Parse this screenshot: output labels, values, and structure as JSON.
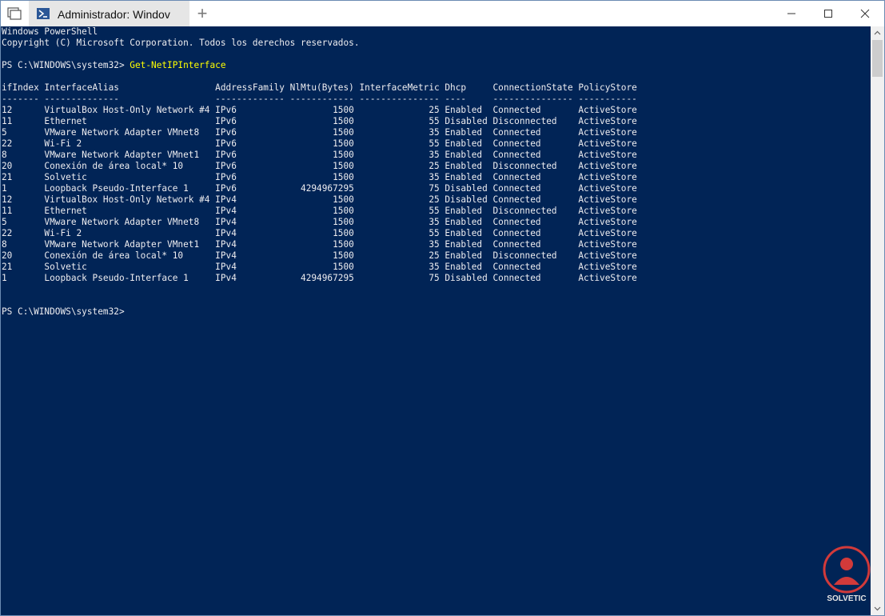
{
  "window": {
    "tab_title": "Administrador: Windov",
    "new_tab_symbol": "+",
    "icons": {
      "tab_switcher": "tab-switcher-icon",
      "tab": "powershell-icon",
      "minimize": "minimize-icon",
      "maximize": "maximize-icon",
      "close": "close-icon"
    }
  },
  "colors": {
    "console_background": "#012456",
    "console_text": "#eeedf0",
    "command_text": "#ffff00"
  },
  "console": {
    "banner_title": "Windows PowerShell",
    "banner_copyright": "Copyright (C) Microsoft Corporation. Todos los derechos reservados.",
    "prompt": "PS C:\\WINDOWS\\system32> ",
    "command": "Get-NetIPInterface",
    "final_prompt": "PS C:\\WINDOWS\\system32>",
    "table_header": "ifIndex InterfaceAlias                  AddressFamily NlMtu(Bytes) InterfaceMetric Dhcp     ConnectionState PolicyStore",
    "table_separator": "------- --------------                  ------------- ------------ --------------- ----     --------------- -----------",
    "columns": [
      "ifIndex",
      "InterfaceAlias",
      "AddressFamily",
      "NlMtu(Bytes)",
      "InterfaceMetric",
      "Dhcp",
      "ConnectionState",
      "PolicyStore"
    ],
    "rows": [
      [
        "12",
        "VirtualBox Host-Only Network #4",
        "IPv6",
        "1500",
        "25",
        "Enabled",
        "Connected",
        "ActiveStore"
      ],
      [
        "11",
        "Ethernet",
        "IPv6",
        "1500",
        "55",
        "Disabled",
        "Disconnected",
        "ActiveStore"
      ],
      [
        "5",
        "VMware Network Adapter VMnet8",
        "IPv6",
        "1500",
        "35",
        "Enabled",
        "Connected",
        "ActiveStore"
      ],
      [
        "22",
        "Wi-Fi 2",
        "IPv6",
        "1500",
        "55",
        "Enabled",
        "Connected",
        "ActiveStore"
      ],
      [
        "8",
        "VMware Network Adapter VMnet1",
        "IPv6",
        "1500",
        "35",
        "Enabled",
        "Connected",
        "ActiveStore"
      ],
      [
        "20",
        "Conexión de área local* 10",
        "IPv6",
        "1500",
        "25",
        "Enabled",
        "Disconnected",
        "ActiveStore"
      ],
      [
        "21",
        "Solvetic",
        "IPv6",
        "1500",
        "35",
        "Enabled",
        "Connected",
        "ActiveStore"
      ],
      [
        "1",
        "Loopback Pseudo-Interface 1",
        "IPv6",
        "4294967295",
        "75",
        "Disabled",
        "Connected",
        "ActiveStore"
      ],
      [
        "12",
        "VirtualBox Host-Only Network #4",
        "IPv4",
        "1500",
        "25",
        "Disabled",
        "Connected",
        "ActiveStore"
      ],
      [
        "11",
        "Ethernet",
        "IPv4",
        "1500",
        "55",
        "Enabled",
        "Disconnected",
        "ActiveStore"
      ],
      [
        "5",
        "VMware Network Adapter VMnet8",
        "IPv4",
        "1500",
        "35",
        "Enabled",
        "Connected",
        "ActiveStore"
      ],
      [
        "22",
        "Wi-Fi 2",
        "IPv4",
        "1500",
        "55",
        "Enabled",
        "Connected",
        "ActiveStore"
      ],
      [
        "8",
        "VMware Network Adapter VMnet1",
        "IPv4",
        "1500",
        "35",
        "Enabled",
        "Connected",
        "ActiveStore"
      ],
      [
        "20",
        "Conexión de área local* 10",
        "IPv4",
        "1500",
        "25",
        "Enabled",
        "Disconnected",
        "ActiveStore"
      ],
      [
        "21",
        "Solvetic",
        "IPv4",
        "1500",
        "35",
        "Enabled",
        "Connected",
        "ActiveStore"
      ],
      [
        "1",
        "Loopback Pseudo-Interface 1",
        "IPv4",
        "4294967295",
        "75",
        "Disabled",
        "Connected",
        "ActiveStore"
      ]
    ]
  },
  "watermark": {
    "text": "SOLVETIC",
    "icon": "solvetic-logo-icon"
  }
}
